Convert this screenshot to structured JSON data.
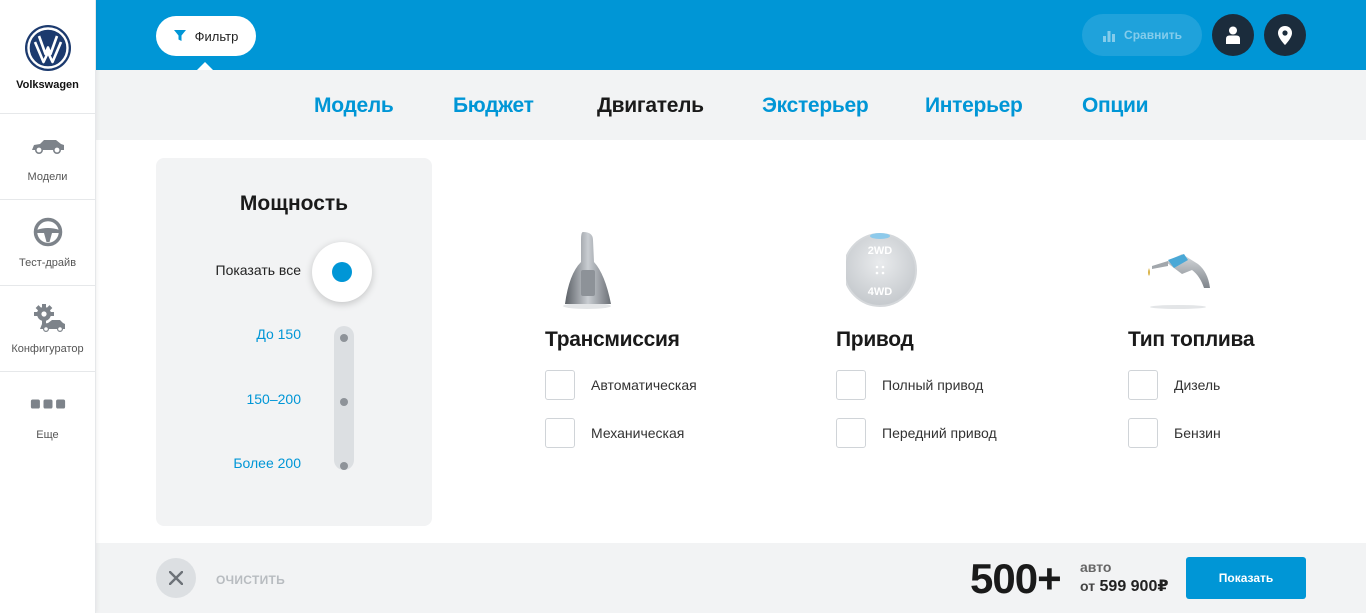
{
  "brand": {
    "name": "Volkswagen"
  },
  "sidebar": {
    "items": [
      {
        "label": "Модели",
        "icon": "car-icon"
      },
      {
        "label": "Тест-драйв",
        "icon": "steering-wheel-icon"
      },
      {
        "label": "Конфигуратор",
        "icon": "configurator-gear-car-icon"
      },
      {
        "label": "Еще",
        "icon": "more-dots-icon"
      }
    ]
  },
  "header": {
    "filter_label": "Фильтр",
    "compare_label": "Сравнить"
  },
  "tabs": [
    {
      "label": "Модель",
      "active": false
    },
    {
      "label": "Бюджет",
      "active": false
    },
    {
      "label": "Двигатель",
      "active": true
    },
    {
      "label": "Экстерьер",
      "active": false
    },
    {
      "label": "Интерьер",
      "active": false
    },
    {
      "label": "Опции",
      "active": false
    }
  ],
  "power": {
    "title": "Мощность",
    "options": [
      "Показать все",
      "До 150",
      "150–200",
      "Более 200"
    ],
    "selected": "Показать все"
  },
  "groups": [
    {
      "title": "Трансмиссия",
      "icon": "gear-shifter-icon",
      "options": [
        "Автоматическая",
        "Механическая"
      ]
    },
    {
      "title": "Привод",
      "icon": "drive-selector-icon",
      "icon_text": [
        "2WD",
        "4WD"
      ],
      "options": [
        "Полный привод",
        "Передний привод"
      ]
    },
    {
      "title": "Тип топлива",
      "icon": "fuel-nozzle-icon",
      "options": [
        "Дизель",
        "Бензин"
      ]
    }
  ],
  "footer": {
    "clear_label": "ОЧИСТИТЬ",
    "count": "500+",
    "count_unit": "авто",
    "price_prefix": "от",
    "price": "599 900₽",
    "show_label": "Показать"
  },
  "colors": {
    "accent": "#0096d6",
    "dark": "#1b2c3c",
    "panel": "#f2f3f4"
  }
}
